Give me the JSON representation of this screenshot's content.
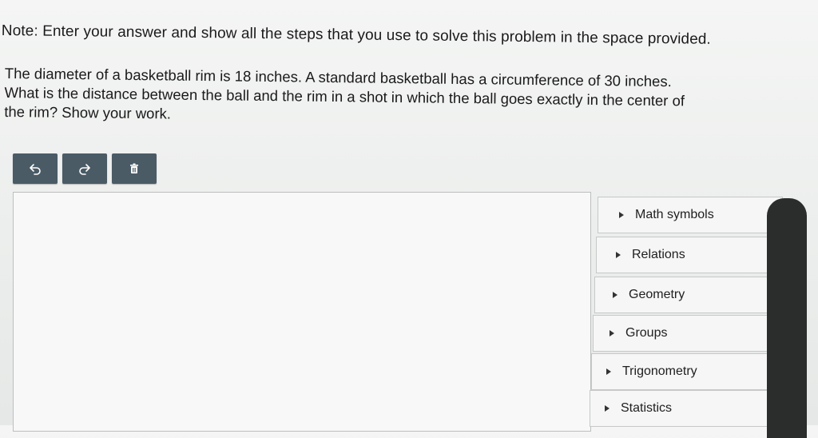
{
  "note": "Note: Enter your answer and show all the steps that you use to solve this problem in the space provided.",
  "question": {
    "lines": [
      "The diameter of a basketball rim is 18 inches. A standard basketball has a circumference of 30 inches.",
      "What is the distance between the ball and the rim in a shot in which the ball goes exactly in the center of",
      "the rim? Show your work."
    ]
  },
  "toolbar": {
    "buttons": [
      {
        "icon": "undo-icon"
      },
      {
        "icon": "redo-icon"
      },
      {
        "icon": "trash-icon"
      }
    ],
    "color": "#4a5b66"
  },
  "answer_area": {
    "value": ""
  },
  "palette": {
    "items": [
      {
        "label": "Math symbols"
      },
      {
        "label": "Relations"
      },
      {
        "label": "Geometry"
      },
      {
        "label": "Groups"
      },
      {
        "label": "Trigonometry"
      },
      {
        "label": "Statistics"
      }
    ]
  }
}
